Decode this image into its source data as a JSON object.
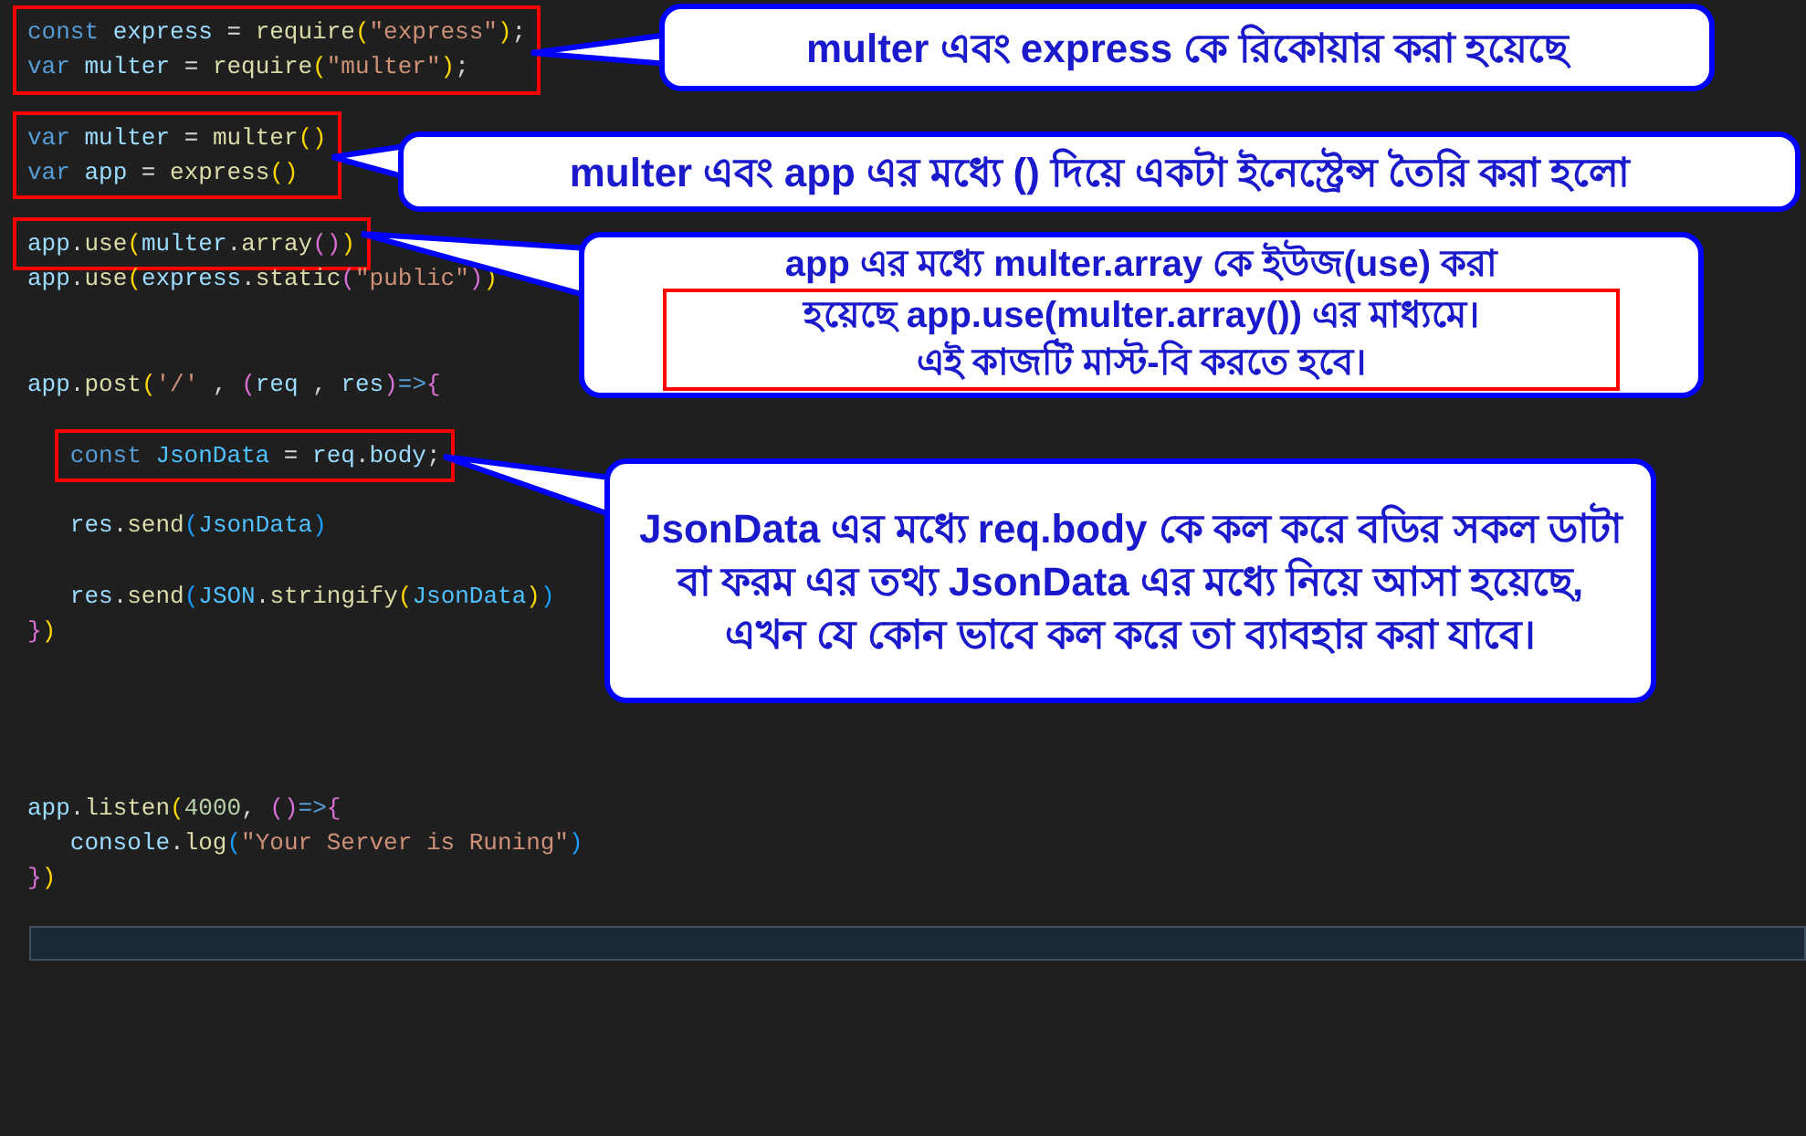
{
  "code": {
    "blocks": [
      {
        "highlighted": true,
        "lines": [
          {
            "kind": "code",
            "tokens": [
              {
                "text": "const ",
                "color": "#569cd6"
              },
              {
                "text": "express",
                "color": "#9cdcfe"
              },
              {
                "text": " = ",
                "color": "#d4d4d4"
              },
              {
                "text": "require",
                "color": "#dcdcaa"
              },
              {
                "text": "(",
                "color": "#ffd700"
              },
              {
                "text": "\"express\"",
                "color": "#ce9178"
              },
              {
                "text": ")",
                "color": "#ffd700"
              },
              {
                "text": ";",
                "color": "#d4d4d4"
              }
            ]
          },
          {
            "kind": "code",
            "tokens": [
              {
                "text": "var ",
                "color": "#569cd6"
              },
              {
                "text": "multer",
                "color": "#9cdcfe"
              },
              {
                "text": " = ",
                "color": "#d4d4d4"
              },
              {
                "text": "require",
                "color": "#dcdcaa"
              },
              {
                "text": "(",
                "color": "#ffd700"
              },
              {
                "text": "\"multer\"",
                "color": "#ce9178"
              },
              {
                "text": ")",
                "color": "#ffd700"
              },
              {
                "text": ";",
                "color": "#d4d4d4"
              }
            ]
          }
        ]
      },
      {
        "highlighted": false,
        "lines": [
          {
            "kind": "blank"
          }
        ]
      },
      {
        "highlighted": true,
        "lines": [
          {
            "kind": "code",
            "tokens": [
              {
                "text": "var ",
                "color": "#569cd6"
              },
              {
                "text": "multer",
                "color": "#9cdcfe"
              },
              {
                "text": " = ",
                "color": "#d4d4d4"
              },
              {
                "text": "multer",
                "color": "#dcdcaa"
              },
              {
                "text": "()",
                "color": "#ffd700"
              }
            ]
          },
          {
            "kind": "code",
            "tokens": [
              {
                "text": "var ",
                "color": "#569cd6"
              },
              {
                "text": "app",
                "color": "#9cdcfe"
              },
              {
                "text": " = ",
                "color": "#d4d4d4"
              },
              {
                "text": "express",
                "color": "#dcdcaa"
              },
              {
                "text": "()",
                "color": "#ffd700"
              }
            ]
          }
        ]
      },
      {
        "highlighted": false,
        "lines": [
          {
            "kind": "blank"
          }
        ]
      },
      {
        "highlighted": true,
        "lines": [
          {
            "kind": "code",
            "tokens": [
              {
                "text": "app",
                "color": "#9cdcfe"
              },
              {
                "text": ".",
                "color": "#d4d4d4"
              },
              {
                "text": "use",
                "color": "#dcdcaa"
              },
              {
                "text": "(",
                "color": "#ffd700"
              },
              {
                "text": "multer",
                "color": "#9cdcfe"
              },
              {
                "text": ".",
                "color": "#d4d4d4"
              },
              {
                "text": "array",
                "color": "#dcdcaa"
              },
              {
                "text": "()",
                "color": "#da70d6"
              },
              {
                "text": ")",
                "color": "#ffd700"
              }
            ]
          }
        ]
      },
      {
        "highlighted": false,
        "lines": [
          {
            "kind": "code",
            "tokens": [
              {
                "text": "app",
                "color": "#9cdcfe"
              },
              {
                "text": ".",
                "color": "#d4d4d4"
              },
              {
                "text": "use",
                "color": "#dcdcaa"
              },
              {
                "text": "(",
                "color": "#ffd700"
              },
              {
                "text": "express",
                "color": "#9cdcfe"
              },
              {
                "text": ".",
                "color": "#d4d4d4"
              },
              {
                "text": "static",
                "color": "#dcdcaa"
              },
              {
                "text": "(",
                "color": "#da70d6"
              },
              {
                "text": "\"public\"",
                "color": "#ce9178"
              },
              {
                "text": ")",
                "color": "#da70d6"
              },
              {
                "text": ")",
                "color": "#ffd700"
              }
            ]
          },
          {
            "kind": "blank"
          },
          {
            "kind": "blank"
          },
          {
            "kind": "code",
            "tokens": [
              {
                "text": "app",
                "color": "#9cdcfe"
              },
              {
                "text": ".",
                "color": "#d4d4d4"
              },
              {
                "text": "post",
                "color": "#dcdcaa"
              },
              {
                "text": "(",
                "color": "#ffd700"
              },
              {
                "text": "'/'",
                "color": "#ce9178"
              },
              {
                "text": " , ",
                "color": "#d4d4d4"
              },
              {
                "text": "(",
                "color": "#da70d6"
              },
              {
                "text": "req",
                "color": "#9cdcfe"
              },
              {
                "text": " , ",
                "color": "#d4d4d4"
              },
              {
                "text": "res",
                "color": "#9cdcfe"
              },
              {
                "text": ")",
                "color": "#da70d6"
              },
              {
                "text": "=>",
                "color": "#569cd6"
              },
              {
                "text": "{",
                "color": "#da70d6"
              }
            ]
          },
          {
            "kind": "blank"
          }
        ]
      },
      {
        "highlighted": true,
        "lines": [
          {
            "kind": "code",
            "tokens": [
              {
                "text": "   const ",
                "color": "#569cd6"
              },
              {
                "text": "JsonData",
                "color": "#4fc1ff"
              },
              {
                "text": " = ",
                "color": "#d4d4d4"
              },
              {
                "text": "req",
                "color": "#9cdcfe"
              },
              {
                "text": ".",
                "color": "#d4d4d4"
              },
              {
                "text": "body",
                "color": "#9cdcfe"
              },
              {
                "text": ";",
                "color": "#d4d4d4"
              }
            ]
          }
        ]
      },
      {
        "highlighted": false,
        "lines": [
          {
            "kind": "blank"
          },
          {
            "kind": "code",
            "tokens": [
              {
                "text": "   res",
                "color": "#9cdcfe"
              },
              {
                "text": ".",
                "color": "#d4d4d4"
              },
              {
                "text": "send",
                "color": "#dcdcaa"
              },
              {
                "text": "(",
                "color": "#179fff"
              },
              {
                "text": "JsonData",
                "color": "#4fc1ff"
              },
              {
                "text": ")",
                "color": "#179fff"
              }
            ]
          },
          {
            "kind": "blank"
          },
          {
            "kind": "code",
            "tokens": [
              {
                "text": "   res",
                "color": "#9cdcfe"
              },
              {
                "text": ".",
                "color": "#d4d4d4"
              },
              {
                "text": "send",
                "color": "#dcdcaa"
              },
              {
                "text": "(",
                "color": "#179fff"
              },
              {
                "text": "JSON",
                "color": "#4fc1ff"
              },
              {
                "text": ".",
                "color": "#d4d4d4"
              },
              {
                "text": "stringify",
                "color": "#dcdcaa"
              },
              {
                "text": "(",
                "color": "#ffd700"
              },
              {
                "text": "JsonData",
                "color": "#4fc1ff"
              },
              {
                "text": ")",
                "color": "#ffd700"
              },
              {
                "text": ")",
                "color": "#179fff"
              }
            ]
          },
          {
            "kind": "code",
            "tokens": [
              {
                "text": "}",
                "color": "#da70d6"
              },
              {
                "text": ")",
                "color": "#ffd700"
              }
            ]
          },
          {
            "kind": "blank"
          },
          {
            "kind": "blank"
          },
          {
            "kind": "blank"
          },
          {
            "kind": "blank"
          },
          {
            "kind": "code",
            "tokens": [
              {
                "text": "app",
                "color": "#9cdcfe"
              },
              {
                "text": ".",
                "color": "#d4d4d4"
              },
              {
                "text": "listen",
                "color": "#dcdcaa"
              },
              {
                "text": "(",
                "color": "#ffd700"
              },
              {
                "text": "4000",
                "color": "#b5cea8"
              },
              {
                "text": ", ",
                "color": "#d4d4d4"
              },
              {
                "text": "()",
                "color": "#da70d6"
              },
              {
                "text": "=>",
                "color": "#569cd6"
              },
              {
                "text": "{",
                "color": "#da70d6"
              }
            ]
          },
          {
            "kind": "code",
            "tokens": [
              {
                "text": "   console",
                "color": "#9cdcfe"
              },
              {
                "text": ".",
                "color": "#d4d4d4"
              },
              {
                "text": "log",
                "color": "#dcdcaa"
              },
              {
                "text": "(",
                "color": "#179fff"
              },
              {
                "text": "\"Your Server is Runing\"",
                "color": "#ce9178"
              },
              {
                "text": ")",
                "color": "#179fff"
              }
            ]
          },
          {
            "kind": "code",
            "tokens": [
              {
                "text": "}",
                "color": "#da70d6"
              },
              {
                "text": ")",
                "color": "#ffd700"
              }
            ]
          }
        ]
      }
    ]
  },
  "callouts": [
    {
      "parts": [
        {
          "text": "multer এবং express কে রিকোয়ার করা হয়েছে",
          "highlighted": false
        }
      ]
    },
    {
      "parts": [
        {
          "text": "multer এবং app এর মধ্যে () দিয়ে একটা ইনেস্ট্রেন্স তৈরি করা হলো",
          "highlighted": false
        }
      ]
    },
    {
      "parts": [
        {
          "text": "app এর মধ্যে multer.array কে ইউজ(use) করা",
          "highlighted": false
        },
        {
          "text": "হয়েছে app.use(multer.array()) এর মাধ্যমে। এই কাজটি মাস্ট-বি করতে হবে।",
          "highlighted": true
        }
      ]
    },
    {
      "parts": [
        {
          "text": "JsonData এর মধ্যে req.body কে কল করে বডির সকল ডাটা বা ফরম এর তথ্য JsonData এর মধ্যে নিয়ে আসা হয়েছে, এখন যে কোন ভাবে কল করে তা ব্যাবহার করা যাবে।",
          "highlighted": false
        }
      ]
    }
  ]
}
